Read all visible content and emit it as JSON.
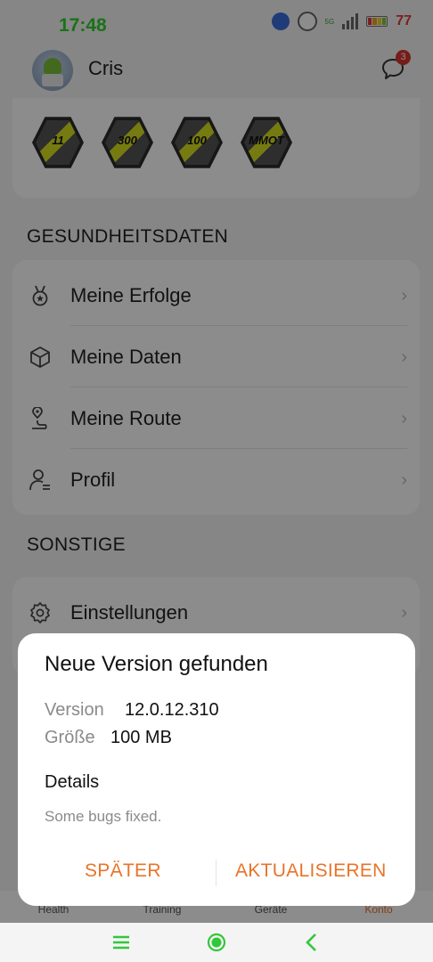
{
  "status_bar": {
    "time": "17:48",
    "network": "5G",
    "battery_text": "77"
  },
  "header": {
    "user_name": "Cris",
    "notification_count": "3"
  },
  "badges": [
    {
      "label": "11"
    },
    {
      "label": "300"
    },
    {
      "label": "100"
    },
    {
      "label": "MMOT"
    }
  ],
  "section_health": {
    "title": "GESUNDHEITSDATEN"
  },
  "menu": [
    {
      "label": "Meine Erfolge",
      "icon": "medal-icon"
    },
    {
      "label": "Meine Daten",
      "icon": "cube-icon"
    },
    {
      "label": "Meine Route",
      "icon": "route-icon"
    },
    {
      "label": "Profil",
      "icon": "person-icon"
    }
  ],
  "section_other": {
    "title": "SONSTIGE"
  },
  "settings": {
    "label": "Einstellungen",
    "icon": "gear-icon"
  },
  "bottom_tabs": [
    "Health",
    "Training",
    "Geräte",
    "Konto"
  ],
  "dialog": {
    "title": "Neue Version gefunden",
    "version_label": "Version",
    "version_value": "12.0.12.310",
    "size_label": "Größe",
    "size_value": "100 MB",
    "details_title": "Details",
    "details_text": "Some bugs fixed.",
    "later_button": "SPÄTER",
    "update_button": "AKTUALISIEREN"
  },
  "colors": {
    "accent": "#e8742a",
    "time": "#31d02d",
    "nav": "#31c73a",
    "badge": "#d9342c"
  }
}
